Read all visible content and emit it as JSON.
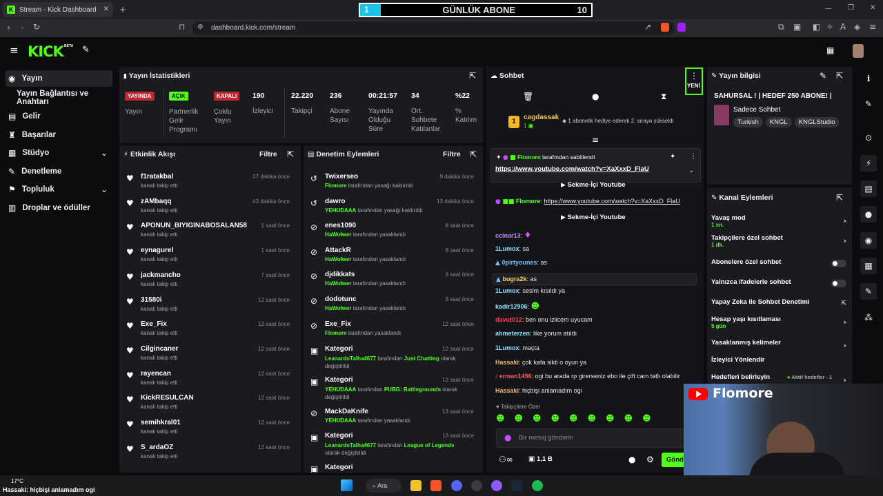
{
  "browser": {
    "tab_title": "Stream - Kick Dashboard",
    "url": "dashboard.kick.com/stream"
  },
  "overlay": {
    "title": "GÜNLÜK ABONE",
    "current": "1",
    "target": "10"
  },
  "header": {
    "logo": "KICK",
    "logo_badge": "BETA"
  },
  "sidebar": {
    "items": [
      {
        "label": "Yayın"
      },
      {
        "label": "Yayın Bağlantısı ve Anahtarı"
      },
      {
        "label": "Gelir"
      },
      {
        "label": "Başarılar"
      },
      {
        "label": "Stüdyo"
      },
      {
        "label": "Denetleme"
      },
      {
        "label": "Topluluk"
      },
      {
        "label": "Droplar ve ödüller"
      }
    ]
  },
  "stats": {
    "title": "Yayın İstatistikleri",
    "badges": [
      {
        "label": "YAYINDA",
        "desc": "Yayın"
      },
      {
        "label": "AÇIK",
        "desc": "Partnerlik Gelir Programı"
      },
      {
        "label": "KAPALI",
        "desc": "Çoklu Yayın"
      }
    ],
    "items": [
      {
        "value": "190",
        "label": "İzleyici"
      },
      {
        "value": "22.220",
        "label": "Takipçi"
      },
      {
        "value": "236",
        "label": "Abone Sayısı"
      },
      {
        "value": "00:21:57",
        "label": "Yayında Olduğu Süre"
      },
      {
        "value": "34",
        "label": "Ort. Sohbete Katılanlar"
      },
      {
        "value": "%22",
        "label": "% Katılım"
      }
    ]
  },
  "activity": {
    "title": "Etkinlik Akışı",
    "filter": "Filtre",
    "sub": "kanalı takip etti",
    "rows": [
      {
        "name": "f1ratakbal",
        "time": "37 dakika önce"
      },
      {
        "name": "zAMbaqq",
        "time": "43 dakika önce"
      },
      {
        "name": "APONUN_BIYIGINABOSALAN58",
        "time": "1 saat önce"
      },
      {
        "name": "eynagurel",
        "time": "1 saat önce"
      },
      {
        "name": "jackmancho",
        "time": "7 saat önce"
      },
      {
        "name": "31580i",
        "time": "12 saat önce"
      },
      {
        "name": "Exe_Fix",
        "time": "12 saat önce"
      },
      {
        "name": "Cilgincaner",
        "time": "12 saat önce"
      },
      {
        "name": "rayencan",
        "time": "12 saat önce"
      },
      {
        "name": "KickRESULCAN",
        "time": "12 saat önce"
      },
      {
        "name": "semihkral01",
        "time": "12 saat önce"
      },
      {
        "name": "S_ardaOZ",
        "time": "12 saat önce"
      }
    ]
  },
  "moderation": {
    "title": "Denetim Eylemleri",
    "filter": "Filtre",
    "rows": [
      {
        "name": "Twixerseo",
        "mod": "Flomore",
        "text": " tarafından yasağı kaldırıldı",
        "time": "9 dakika önce",
        "icon": "↺"
      },
      {
        "name": "dawro",
        "mod": "YEHUDAAA",
        "text": " tarafından yasağı kaldırıldı",
        "time": "13 dakika önce",
        "icon": "↺"
      },
      {
        "name": "enes1090",
        "mod": "HaWolwer",
        "text": " tarafından yasaklandı",
        "time": "8 saat önce",
        "icon": "⊘"
      },
      {
        "name": "AttackR",
        "mod": "HaWolwer",
        "text": " tarafından yasaklandı",
        "time": "8 saat önce",
        "icon": "⊘"
      },
      {
        "name": "djdikkats",
        "mod": "HaWolwer",
        "text": " tarafından yasaklandı",
        "time": "8 saat önce",
        "icon": "⊘"
      },
      {
        "name": "dodotunc",
        "mod": "HaWolwer",
        "text": " tarafından yasaklandı",
        "time": "8 saat önce",
        "icon": "⊘"
      },
      {
        "name": "Exe_Fix",
        "mod": "Flomore",
        "text": " tarafından yasaklandı",
        "time": "12 saat önce",
        "icon": "⊘"
      }
    ],
    "cat_rows": [
      {
        "name": "Kategori",
        "mod": "LeanardoTalha4677",
        "text": " tarafından ",
        "game": "Just Chatting",
        "end": " olarak değiştirildi",
        "time": "12 saat önce"
      },
      {
        "name": "Kategori",
        "mod": "YEHUDAAA",
        "text": " tarafından ",
        "game": "PUBG: Battlegrounds",
        "end": " olarak değiştirildi",
        "time": "12 saat önce"
      }
    ],
    "row_mack": {
      "name": "MackDaKnife",
      "mod": "YEHUDAAA",
      "text": " tarafından yasaklandı",
      "time": "13 saat önce"
    },
    "cat_row3": {
      "name": "Kategori",
      "mod": "LeanardoTalha4677",
      "text": " tarafından ",
      "game": "League of Legends",
      "end": " olarak değiştirildi",
      "time": "13 saat önce"
    },
    "last": "Kategori"
  },
  "chat": {
    "title": "Sohbet",
    "new": "YENİ",
    "gift_user": "cagdassak",
    "gift_count": "1",
    "gift_text": "1 abonelik hediye ederek 2. sıraya yükseldi",
    "pinned_by": "Flomore",
    "pinned_text": " tarafından sabitlendi",
    "pinned_link": "https://www.youtube.com/watch?v=XaXxxD_FlaU",
    "inapp": "Sekme-İçi Youtube",
    "msg_user": "Flomore",
    "msg_link": "https://www.youtube.com/watch?v=XaXxxD_FlaU",
    "lines": [
      {
        "user": "ccinar13",
        "text": "",
        "color": "#c08cff"
      },
      {
        "user": "1Lumox",
        "text": " sa",
        "color": "#8ee0ff"
      },
      {
        "user": "0pirtyounes",
        "text": " as",
        "color": "#6ec3ff"
      },
      {
        "user": "bugra2k",
        "text": " as",
        "color": "#ffd84d"
      },
      {
        "user": "1Lumox",
        "text": " sesim kısıldı ya",
        "color": "#8ee0ff"
      },
      {
        "user": "kadir12906",
        "text": "",
        "color": "#8ee0ff"
      },
      {
        "user": "davut012",
        "text": " ben onu izlicem uyucam",
        "color": "#ff4040"
      },
      {
        "user": "ahmeterzen",
        "text": " like yorum atıldı",
        "color": "#8ee0ff"
      },
      {
        "user": "1Lumox",
        "text": " maçta",
        "color": "#8ee0ff"
      },
      {
        "user": "Hassaki",
        "text": " çok kafa sikti o oyun ya",
        "color": "#ffb36e"
      },
      {
        "user": "erman1496",
        "text": " ogi bu arada rp girerseniz ebo ile çift cam tatlı olabilir",
        "color": "#ff5a5a"
      },
      {
        "user": "Hassaki",
        "text": " hiçbişi anlamadım ogi",
        "color": "#ffb36e"
      }
    ],
    "followers_only": "Takipçilere Özel",
    "placeholder": "Bir mesaj gönderin",
    "points": "1,1 B",
    "send": "Gönd"
  },
  "info": {
    "title": "Yayın bilgisi",
    "stream_title": "SAHURSAL ! | HEDEF 250 ABONE! |",
    "category": "Sadece Sohbet",
    "tags": [
      "Turkish",
      "KNGL",
      "KNGLStudio"
    ]
  },
  "actions": {
    "title": "Kanal Eylemleri",
    "items": [
      {
        "label": "Yavaş mod",
        "sub": "1 sn."
      },
      {
        "label": "Takipçilere özel sohbet",
        "sub": "1 dk."
      },
      {
        "label": "Abonelere özel sohbet",
        "sub": ""
      },
      {
        "label": "Yalnızca ifadelerle sohbet",
        "sub": ""
      },
      {
        "label": "Yapay Zeka ile Sohbet Denetimi",
        "sub": ""
      },
      {
        "label": "Hesap yaşı kısıtlaması",
        "sub": "5 gün"
      },
      {
        "label": "Yasaklanmış kelimeler",
        "sub": ""
      },
      {
        "label": "İzleyici Yönlendir",
        "sub": ""
      },
      {
        "label": "Hedefleri belirleyin",
        "sub": "Aktif hedefler - 1"
      }
    ]
  },
  "webcam": {
    "name": "Flomore"
  },
  "taskbar": {
    "temp": "17°C",
    "search": "Ara",
    "ticker_user": "Hassaki",
    "ticker_text": "hiçbişi anlamadım ogi"
  }
}
